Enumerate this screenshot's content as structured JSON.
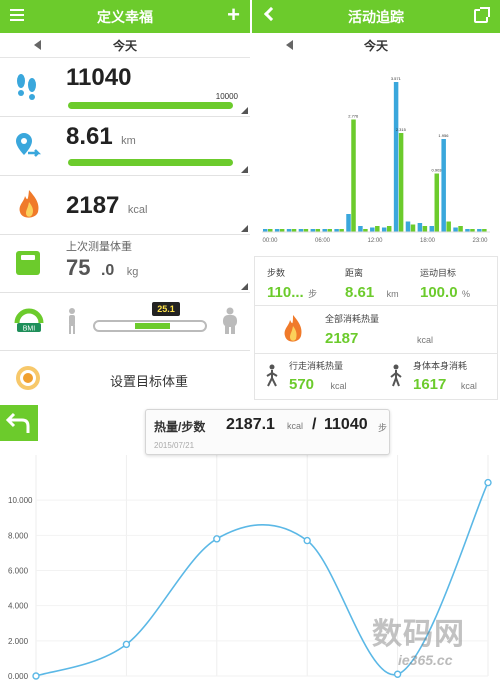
{
  "left_panel": {
    "title": "定义幸福",
    "date_label": "今天",
    "steps": {
      "value": "11040",
      "goal": "10000",
      "progress": 1.0
    },
    "distance": {
      "value": "8.61",
      "unit": "km",
      "progress": 1.0
    },
    "calories": {
      "value": "2187",
      "unit": "kcal"
    },
    "weight": {
      "label": "上次测量体重",
      "value": "75",
      "decimal": ".0",
      "unit": "kg"
    },
    "bmi": {
      "label": "BMI",
      "value": "25.1",
      "position": 0.66
    },
    "target_weight_label": "设置目标体重"
  },
  "right_panel": {
    "title": "活动追踪",
    "date_label": "今天",
    "x_ticks": [
      "00:00",
      "06:00",
      "12:00",
      "18:00",
      "23:00"
    ],
    "bars": [
      {
        "blue": 0.02,
        "green": 0.02
      },
      {
        "blue": 0.02,
        "green": 0.02
      },
      {
        "blue": 0.02,
        "green": 0.02
      },
      {
        "blue": 0.02,
        "green": 0.02
      },
      {
        "blue": 0.02,
        "green": 0.02
      },
      {
        "blue": 0.02,
        "green": 0.02
      },
      {
        "blue": 0.02,
        "green": 0.02
      },
      {
        "blue": 0.12,
        "green": 0.75
      },
      {
        "blue": 0.04,
        "green": 0.02
      },
      {
        "blue": 0.03,
        "green": 0.04
      },
      {
        "blue": 0.03,
        "green": 0.04
      },
      {
        "blue": 1.0,
        "green": 0.66
      },
      {
        "blue": 0.07,
        "green": 0.05
      },
      {
        "blue": 0.06,
        "green": 0.04
      },
      {
        "blue": 0.04,
        "green": 0.39
      },
      {
        "blue": 0.62,
        "green": 0.07
      },
      {
        "blue": 0.03,
        "green": 0.04
      },
      {
        "blue": 0.02,
        "green": 0.02
      },
      {
        "blue": 0.02,
        "green": 0.02
      }
    ],
    "bar_labels": {
      "b7": "2.776",
      "b11": "3.571",
      "b11g": "2.315",
      "b15": "1.956",
      "b14": "0.903"
    },
    "stats": {
      "steps_label": "步数",
      "steps_value": "110...",
      "steps_unit": "步",
      "distance_label": "距离",
      "distance_value": "8.61",
      "distance_unit": "km",
      "goal_label": "运动目标",
      "goal_value": "100.0",
      "goal_unit": "%",
      "total_cal_label": "全部消耗热量",
      "total_cal_value": "2187",
      "total_cal_unit": "kcal",
      "walk_cal_label": "行走消耗热量",
      "walk_cal_value": "570",
      "walk_cal_unit": "kcal",
      "body_cal_label": "身体本身消耗",
      "body_cal_value": "1617",
      "body_cal_unit": "kcal"
    }
  },
  "bottom": {
    "popup_label": "热量/步数",
    "popup_cal": "2187.1",
    "popup_cal_unit": "kcal",
    "popup_sep": "/",
    "popup_steps": "11040",
    "popup_steps_unit": "步",
    "popup_date": "2015/07/21",
    "watermark_text": "数码网",
    "watermark_domain": "ie365.cc"
  },
  "chart_data": {
    "type": "line",
    "x": [
      0,
      1,
      2,
      3,
      4,
      5
    ],
    "values": [
      0,
      1.8,
      7.8,
      7.7,
      0.1,
      11.0
    ],
    "ylim": [
      0,
      12
    ],
    "y_ticks": [
      "0.000",
      "2.000",
      "4.000",
      "6.000",
      "8.000",
      "10.000"
    ],
    "grid": true,
    "color": "#5bb8e6"
  },
  "colors": {
    "accent": "#6ccb2c",
    "blue": "#3aa7dc"
  }
}
